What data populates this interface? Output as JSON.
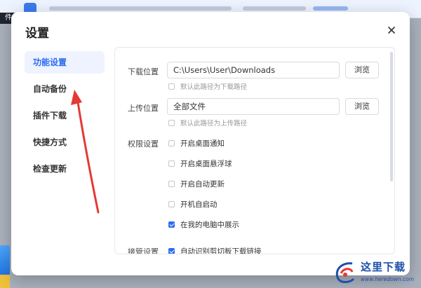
{
  "window": {
    "title": "设置",
    "close_icon": "close-icon"
  },
  "background_tag": "件",
  "sidebar": {
    "items": [
      {
        "label": "功能设置",
        "active": true
      },
      {
        "label": "自动备份",
        "active": false
      },
      {
        "label": "插件下载",
        "active": false
      },
      {
        "label": "快捷方式",
        "active": false
      },
      {
        "label": "检查更新",
        "active": false
      }
    ]
  },
  "settings": {
    "download": {
      "label": "下载位置",
      "path": "C:\\Users\\User\\Downloads",
      "browse": "浏览",
      "default_hint": "默认此路径为下载路径",
      "default_checked": false
    },
    "upload": {
      "label": "上传位置",
      "path": "全部文件",
      "browse": "浏览",
      "default_hint": "默认此路径为上传路径",
      "default_checked": false
    },
    "permissions": {
      "label": "权限设置",
      "options": [
        {
          "label": "开启桌面通知",
          "checked": false
        },
        {
          "label": "开启桌面悬浮球",
          "checked": false
        },
        {
          "label": "开启自动更新",
          "checked": false
        },
        {
          "label": "开机自启动",
          "checked": false
        },
        {
          "label": "在我的电脑中展示",
          "checked": true
        }
      ]
    },
    "takeover": {
      "label": "接管设置",
      "options": [
        {
          "label": "自动识别剪切板下载链接",
          "checked": true
        }
      ]
    }
  },
  "annotation": {
    "color": "#e53935"
  },
  "watermark": {
    "text": "这里下载",
    "url": "www.heredown.com"
  }
}
